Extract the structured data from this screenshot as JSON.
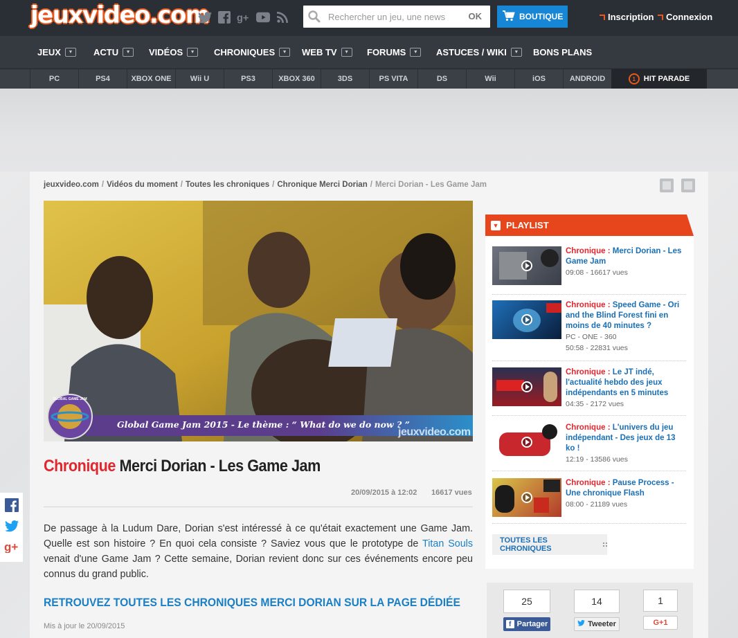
{
  "header": {
    "logo": "jeuxvideo.com",
    "socials": [
      "twitter-icon",
      "facebook-icon",
      "googleplus-icon",
      "youtube-icon",
      "rss-icon"
    ],
    "search": {
      "placeholder": "Rechercher un jeu, une news",
      "ok": "OK"
    },
    "boutique": "BOUTIQUE",
    "inscription": "Inscription",
    "connexion": "Connexion"
  },
  "nav": {
    "items": [
      "JEUX",
      "ACTU",
      "VIDÉOS",
      "CHRONIQUES",
      "WEB TV",
      "FORUMS",
      "ASTUCES / WIKI",
      "BONS PLANS"
    ]
  },
  "platforms": {
    "items": [
      "PC",
      "PS4",
      "XBOX ONE",
      "Wii U",
      "PS3",
      "XBOX 360",
      "3DS",
      "PS VITA",
      "DS",
      "Wii",
      "iOS",
      "ANDROID"
    ],
    "hit": "HIT PARADE",
    "hit_badge": "1"
  },
  "breadcrumb": [
    "jeuxvideo.com",
    "Vidéos du moment",
    "Toutes les chroniques",
    "Chronique Merci Dorian",
    "Merci Dorian - Les Game Jam"
  ],
  "video": {
    "banner": "Global Game Jam 2015 - Le thème : “ What do we do now ? ”",
    "watermark": "jeuxvideo.com",
    "badge": "GLOBAL GAME JAM"
  },
  "article": {
    "kicker": "Chronique",
    "title": "Merci Dorian - Les Game Jam",
    "date": "20/09/2015 à 12:02",
    "views": "16617 vues",
    "body_1": "De passage à la Ludum Dare, Dorian s'est intéressé à ce qu'était exactement une Game Jam. Quelle est son histoire ? En quoi cela consiste ? Saviez vous que le prototype de ",
    "body_link": "Titan Souls",
    "body_2": " venait d'une Game Jam ? Cette semaine, Dorian revient donc sur ces événements encore peu connus du grand public.",
    "see_all": "RETROUVEZ TOUTES LES CHRONIQUES MERCI DORIAN SUR LA PAGE DÉDIÉE",
    "updated": "Mis à jour le 20/09/2015"
  },
  "playlist": {
    "title": "PLAYLIST",
    "items": [
      {
        "kicker": "Chronique :",
        "title": "Merci Dorian - Les Game Jam",
        "line1": "09:08 - 16617 vues",
        "line2": ""
      },
      {
        "kicker": "Chronique :",
        "title": "Speed Game - Ori and the Blind Forest fini en moins de 40 minutes ?",
        "line1": "PC - ONE - 360",
        "line2": "50:58 - 22831 vues"
      },
      {
        "kicker": "Chronique :",
        "title": "Le JT indé, l'actualité hebdo des jeux indépendants en 5 minutes",
        "line1": "04:35 - 2172 vues",
        "line2": ""
      },
      {
        "kicker": "Chronique :",
        "title": "L'univers du jeu indépendant - Des jeux de 13 ko !",
        "line1": "12:19 - 13586 vues",
        "line2": ""
      },
      {
        "kicker": "Chronique :",
        "title": "Pause Process - Une chronique Flash",
        "line1": "08:00 - 21189 vues",
        "line2": ""
      }
    ],
    "all": "TOUTES LES CHRONIQUES"
  },
  "share": {
    "facebook": {
      "count": "25",
      "label": "Partager"
    },
    "twitter": {
      "count": "14",
      "label": "Tweeter"
    },
    "gplus": {
      "count": "1",
      "label": "G+1"
    }
  },
  "colors": {
    "brand": "#e9581c",
    "accent_red": "#e2262e",
    "link_blue": "#1a7fc4",
    "boutique_blue": "#1786d4"
  }
}
